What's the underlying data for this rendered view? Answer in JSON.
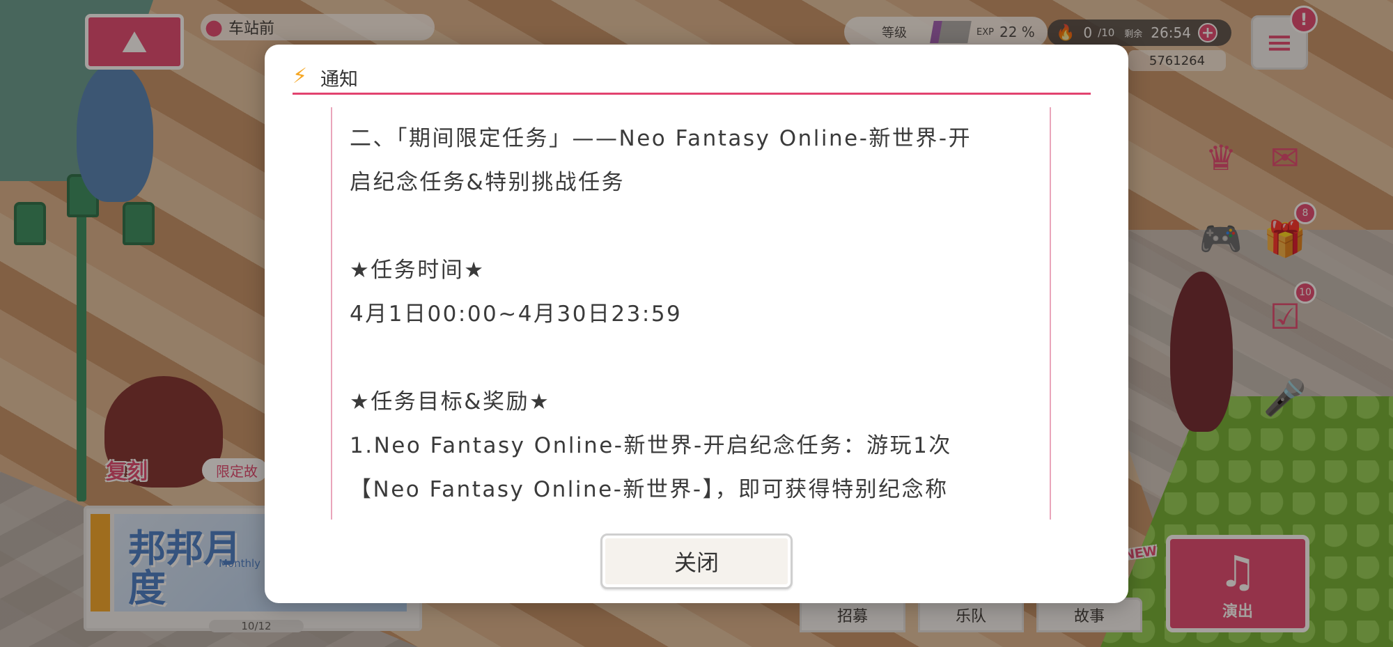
{
  "hud": {
    "location": "车站前",
    "level_label": "等级",
    "exp_label": "EXP",
    "exp_percent": "22 %",
    "exp_fraction": 0.22,
    "stamina_current": "0",
    "stamina_max": "/10",
    "stamina_remaining_label": "剩余",
    "stamina_timer": "26:54",
    "coins": "5761264",
    "alert_badge": "!",
    "gift_badge": "8",
    "mission_badge": "10"
  },
  "icons": {
    "map": "map-pin-icon",
    "location": "location-pin-icon",
    "menu": "hamburger-menu-icon",
    "crown": "crown-icon",
    "ticket": "ticket-icon",
    "gamepad": "gamepad-icon",
    "gift": "gift-icon",
    "mission": "calendar-check-icon",
    "microphone": "microphone-icon",
    "flame": "flame-icon",
    "plus": "plus-icon",
    "notice": "lightning-icon",
    "guitar": "guitar-icon"
  },
  "banner": {
    "title": "邦邦月度",
    "subtitle": "Monthly Ra",
    "pager": "10/12",
    "revival_tag": "复刻",
    "limited_tag": "限定故"
  },
  "bottom_nav": {
    "recruit": "招募",
    "band": "乐队",
    "story": "故事",
    "perform": "演出",
    "new_tag": "NEW"
  },
  "modal": {
    "title": "通知",
    "lines": [
      "二、「期间限定任务」——Neo Fantasy Online-新世界-开",
      "启纪念任务&特别挑战任务",
      "",
      "★任务时间★",
      "4月1日00:00~4月30日23:59",
      "",
      "★任务目标&奖励★",
      "1.Neo Fantasy Online-新世界-开启纪念任务：游玩1次",
      "【Neo Fantasy Online-新世界-】，即可获得特别纪念称"
    ],
    "close_label": "关闭"
  },
  "colors": {
    "accent": "#e2436f",
    "frame_line": "#e9a5ba",
    "text": "#3a3a3a"
  }
}
